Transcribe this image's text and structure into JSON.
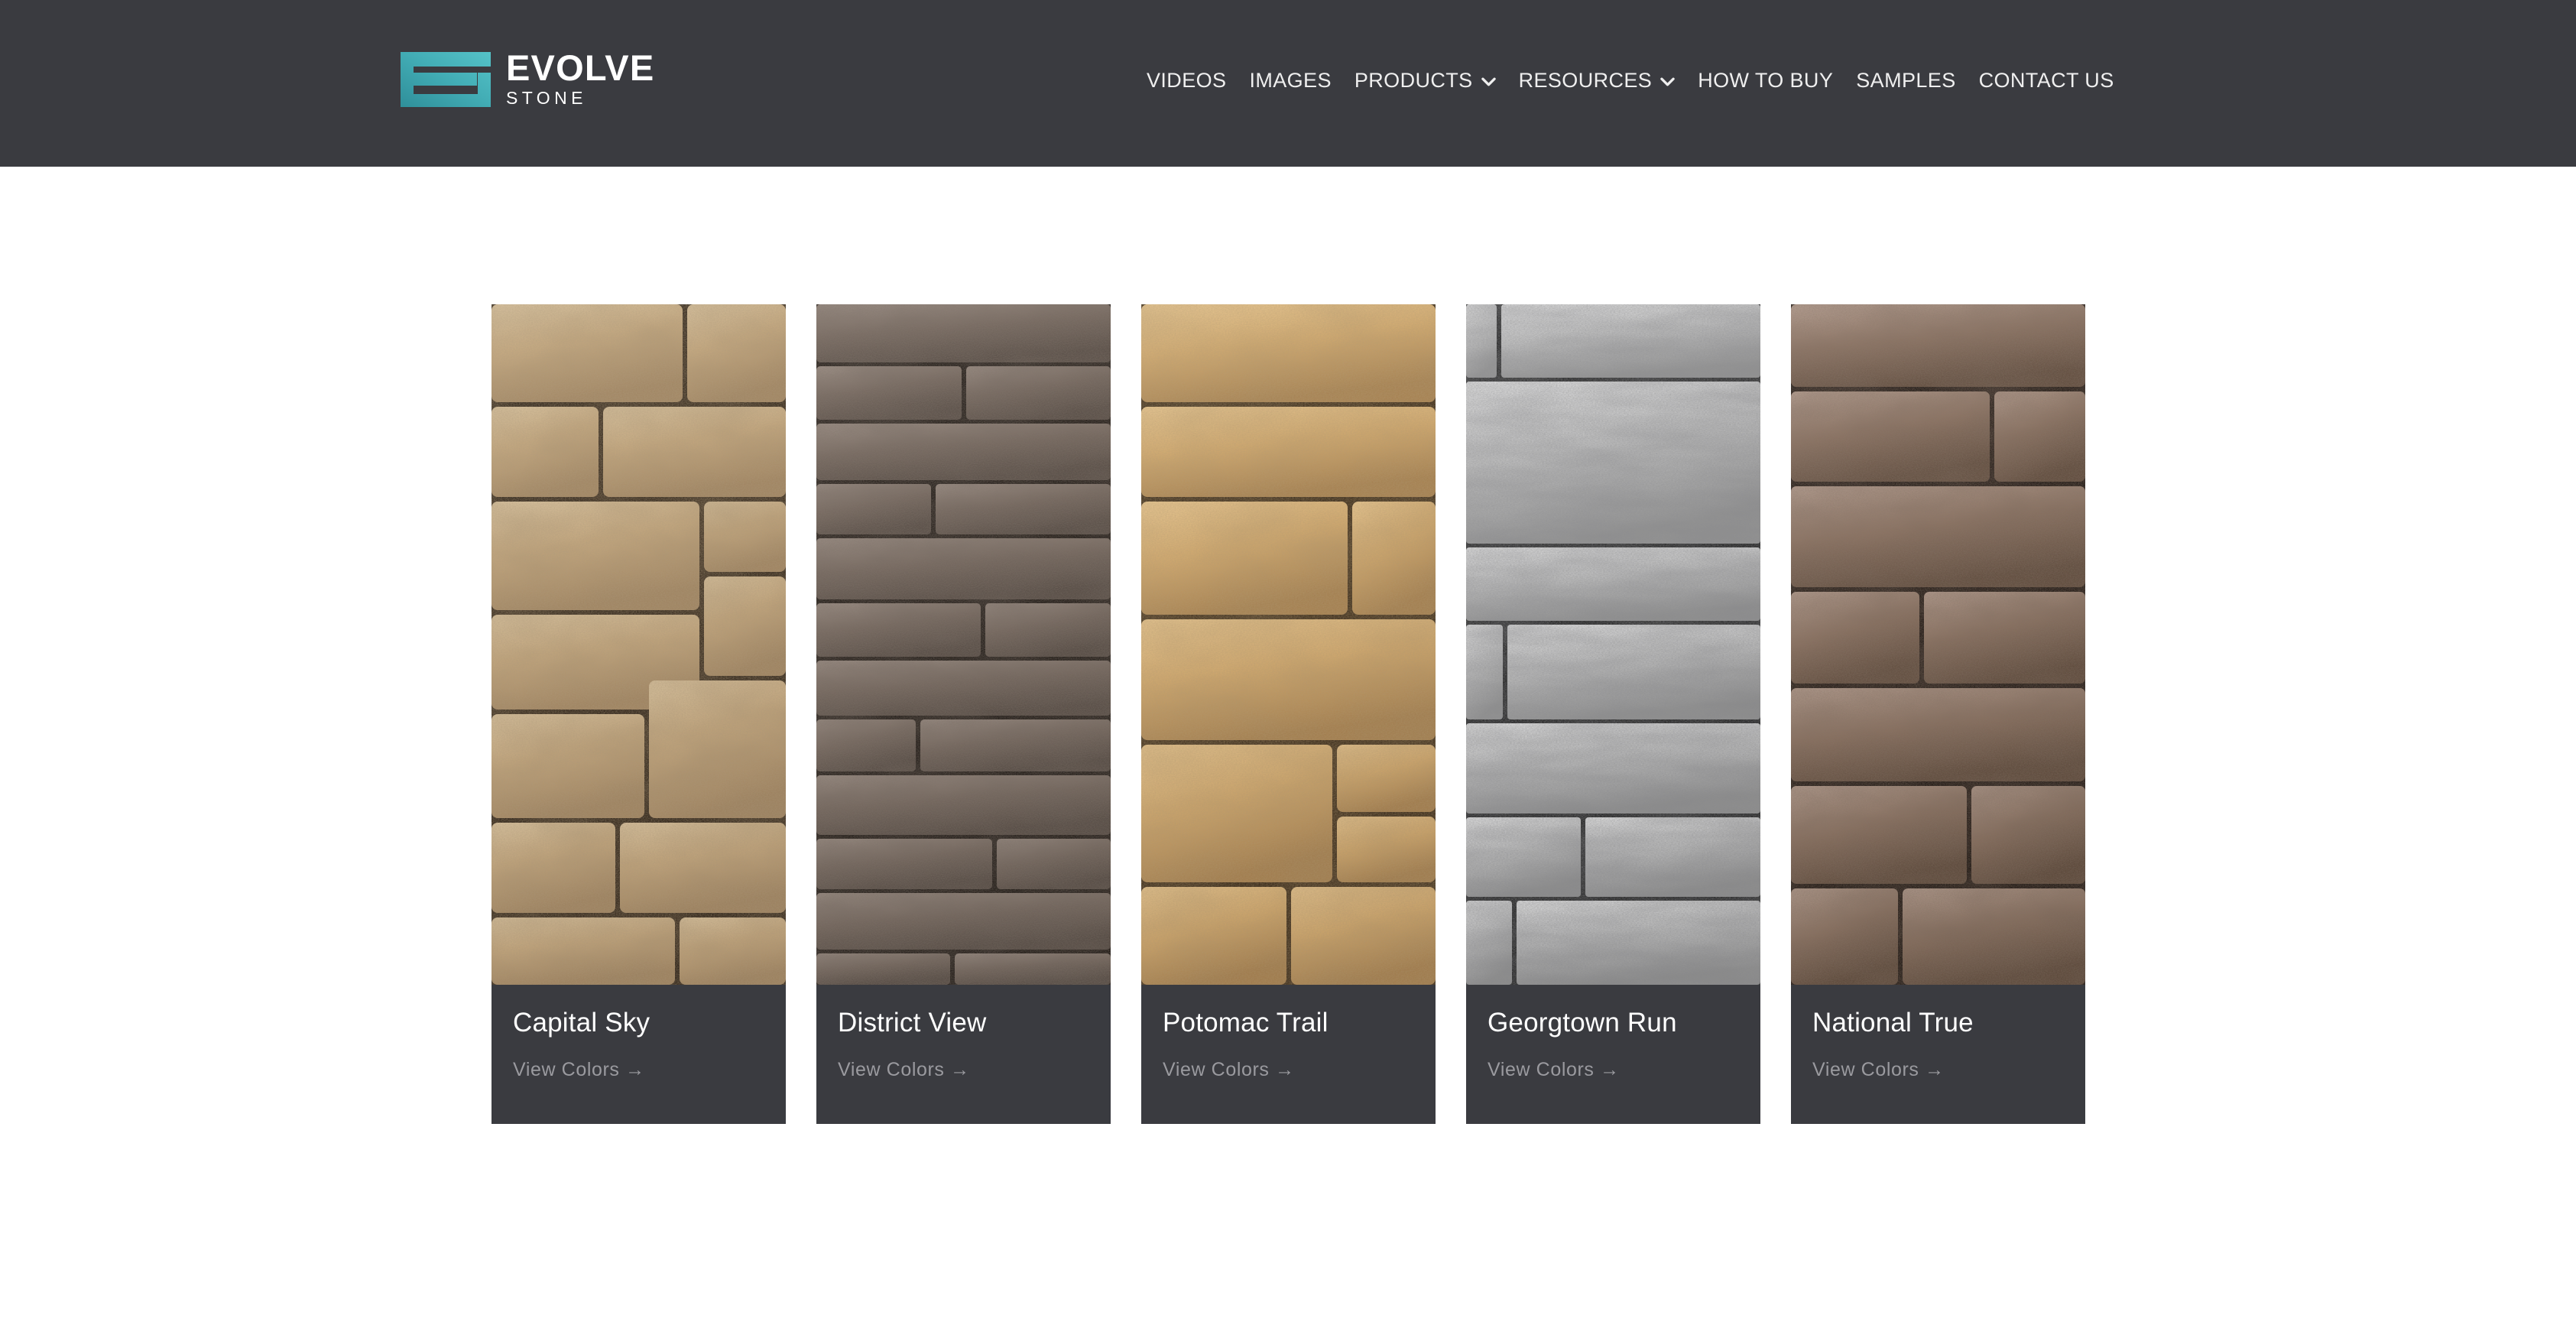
{
  "header": {
    "background_color": "#3a3b40",
    "brand": {
      "name": "EVOLVE",
      "sub": "STONE",
      "mark_icon": "evolve-stone-monogram-icon",
      "mark_color_light": "#4db9c0",
      "mark_color_dark": "#2f8f9a"
    },
    "nav": [
      {
        "label": "VIDEOS",
        "has_caret": false
      },
      {
        "label": "IMAGES",
        "has_caret": false
      },
      {
        "label": "PRODUCTS",
        "has_caret": true
      },
      {
        "label": "RESOURCES",
        "has_caret": true
      },
      {
        "label": "HOW TO BUY",
        "has_caret": false
      },
      {
        "label": "SAMPLES",
        "has_caret": false
      },
      {
        "label": "CONTACT US",
        "has_caret": false
      }
    ]
  },
  "main": {
    "background_color": "#ffffff",
    "caption_background_color": "#3a3b40",
    "link_label": "View Colors",
    "link_arrow": "→",
    "cards": [
      {
        "title": "Capital Sky",
        "link": "View Colors →",
        "swatch_icon": "stone-texture-capital-sky",
        "tone_light": "#dcc7a4",
        "tone_mid": "#b79b74",
        "tone_dark": "#6d5741",
        "tone_deep": "#2a2018",
        "pattern": "ashlar-blocks"
      },
      {
        "title": "District View",
        "link": "View Colors →",
        "swatch_icon": "stone-texture-district-view",
        "tone_light": "#a2948a",
        "tone_mid": "#7b6d64",
        "tone_dark": "#514843",
        "tone_deep": "#201b18",
        "pattern": "running-bond-courses"
      },
      {
        "title": "Potomac Trail",
        "link": "View Colors →",
        "swatch_icon": "stone-texture-potomac-trail",
        "tone_light": "#e6c694",
        "tone_mid": "#c9a472",
        "tone_dark": "#8a6a46",
        "tone_deep": "#2e2217",
        "pattern": "large-ashlar"
      },
      {
        "title": "Georgtown Run",
        "link": "View Colors →",
        "swatch_icon": "stone-texture-georgtown-run",
        "tone_light": "#e4e4e4",
        "tone_mid": "#b5b5b5",
        "tone_dark": "#7d7d7d",
        "tone_deep": "#1e1e1e",
        "pattern": "granite-courses"
      },
      {
        "title": "National True",
        "link": "View Colors →",
        "swatch_icon": "stone-texture-national-true",
        "tone_light": "#b9a394",
        "tone_mid": "#8b7364",
        "tone_dark": "#584539",
        "tone_deep": "#1d1713",
        "pattern": "rough-ashlar"
      }
    ]
  }
}
